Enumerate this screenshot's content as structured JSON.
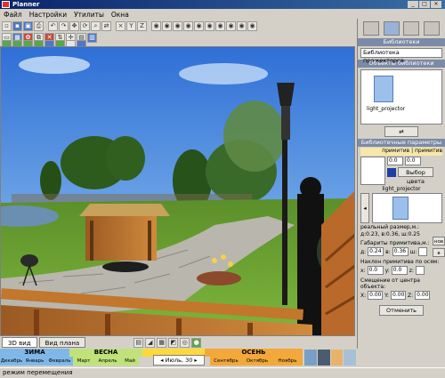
{
  "title": "Planner",
  "menu": [
    "Файл",
    "Настройки",
    "Утилиты",
    "Окна"
  ],
  "toolbar_letters": {
    "y": "Y",
    "z": "Z"
  },
  "view_tabs": [
    "3D вид",
    "Вид плана"
  ],
  "seasons": {
    "winter": "ЗИМА",
    "spring": "ВЕСНА",
    "autumn": "ОСЕНЬ",
    "months_left": [
      "Декабрь",
      "Январь",
      "Февраль",
      "Март",
      "Апрель",
      "Май"
    ],
    "current_date": "Июль, 30",
    "months_right": [
      "Сентябрь",
      "Октябрь",
      "Ноябрь"
    ]
  },
  "status": "режим перемещения",
  "panel": {
    "libraries_header": "Библиотеки",
    "library_name": "Библиотека прожекторов",
    "objects_header": "Объекты библиотеки",
    "object_label": "light_projector",
    "params_header": "Библиотечные параметры об...",
    "tabs_text": "примитив | примитив",
    "spin_a": "0.0",
    "spin_b": "0.0",
    "color_button": "Выбор цвета",
    "primitive_name": "light_projector",
    "real_size_label": "реальный размер,м.:",
    "real_size_values": "д:0.23, в:0.36, ш:0.25",
    "side_btn_new": "нов",
    "side_btn_b": "в",
    "dims_label": "Габариты примитива,м.:",
    "dims": {
      "d_label": "д:",
      "d": "0.24",
      "v_label": "в:",
      "v": "0.36",
      "sh_label": "ш:"
    },
    "tilt_label": "Наклон примитива по осям:",
    "tilt": {
      "x_label": "x:",
      "x": "0.0",
      "y_label": "y:",
      "y": "0.0",
      "z_label": "z:"
    },
    "offset_label": "Смещение от центра объекта:",
    "offset": {
      "x_label": "X:",
      "x": "0.00",
      "y_label": "Y:",
      "y": "0.00",
      "z_label": "Z:",
      "z": "0.00"
    },
    "cancel": "Отменить"
  }
}
